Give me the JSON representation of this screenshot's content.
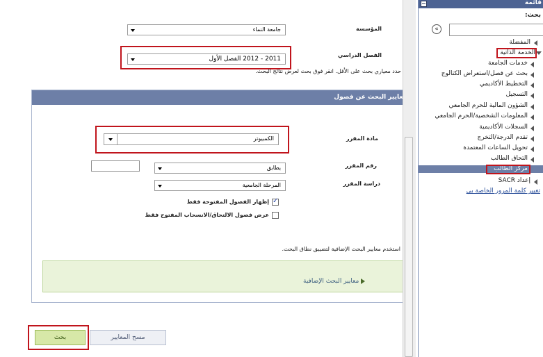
{
  "form": {
    "institution_label": "المؤسسة",
    "institution_value": "جامعة النماء",
    "term_label": "الفصل الدراسي",
    "term_value": "2011 - 2012 الفصل الأول",
    "instructions": "حدد معياري بحث على الأقل. انقر فوق بحث لعرض نتائج البحث."
  },
  "criteria": {
    "header": "معايير البحث عن فصول",
    "subject_label": "مادة المقرر",
    "subject_value": "الكمبيوتر",
    "course_number_label": "رقم المقرر",
    "course_number_op": "يطابق",
    "course_number_value": "",
    "career_label": "دراسة المقرر",
    "career_value": "المرحلة الجامعية",
    "open_only_label": "إظهار الفصول المفتوحة فقط",
    "open_only_checked": true,
    "open_enroll_label": "عرض فصول الالتحاق/الانسحاب المفتوح فقط",
    "open_enroll_checked": false,
    "additional_hint": "استخدم معايير البحث الإضافية لتضييق نطاق البحث.",
    "additional_link": "معايير البحث الإضافية"
  },
  "buttons": {
    "search": "بحث",
    "clear": "مسح المعايير"
  },
  "nav": {
    "title": "قائمة",
    "search_label": "بحث:",
    "search_value": "",
    "favorites": "المفضلة",
    "self_service": "الخدمة الذاتية",
    "items": [
      "خدمات الجامعة",
      "بحث عن فصل/استعراض الكتالوج",
      "التخطيط الأكاديمي",
      "التسجيل",
      "الشؤون المالية للحرم الجامعي",
      "المعلومات الشخصية/الحرم الجامعي",
      "السجلات الأكاديمية",
      "تقدم الدرجة/التخرج",
      "تحويل الساعات المعتمدة",
      "التحاق الطالب"
    ],
    "student_center": "مركز الطالب",
    "sacr": "إعداد SACR",
    "change_password": "تغيير كلمة المرور الخاصة بي"
  }
}
